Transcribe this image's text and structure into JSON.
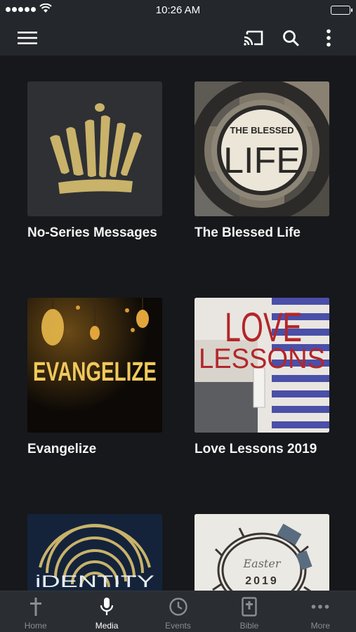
{
  "status_bar": {
    "time": "10:26 AM"
  },
  "toolbar": {
    "menu_icon": "hamburger-menu-icon",
    "cast_icon": "cast-icon",
    "search_icon": "search-icon",
    "more_icon": "vertical-ellipsis-icon"
  },
  "series": [
    {
      "title": "No-Series Messages",
      "art_text": ""
    },
    {
      "title": "The Blessed Life",
      "art_line1": "THE BLESSED",
      "art_line2": "LIFE"
    },
    {
      "title": "Evangelize",
      "art_text": "EVANGELIZE"
    },
    {
      "title": "Love Lessons 2019",
      "art_line1": "LOVE",
      "art_line2": "LESSONS"
    },
    {
      "title": "",
      "art_text": "iDENTITY"
    },
    {
      "title": "",
      "art_line1": "Easter",
      "art_line2": "2019"
    }
  ],
  "tabs": [
    {
      "label": "Home",
      "icon": "cross-icon",
      "active": false
    },
    {
      "label": "Media",
      "icon": "microphone-icon",
      "active": true
    },
    {
      "label": "Events",
      "icon": "clock-icon",
      "active": false
    },
    {
      "label": "Bible",
      "icon": "bible-icon",
      "active": false
    },
    {
      "label": "More",
      "icon": "more-dots-icon",
      "active": false
    }
  ],
  "colors": {
    "background": "#16181b",
    "toolbar": "#24272b",
    "tabbar": "#2a2d31",
    "gold": "#c9b26a",
    "red_accent": "#b3262a"
  }
}
